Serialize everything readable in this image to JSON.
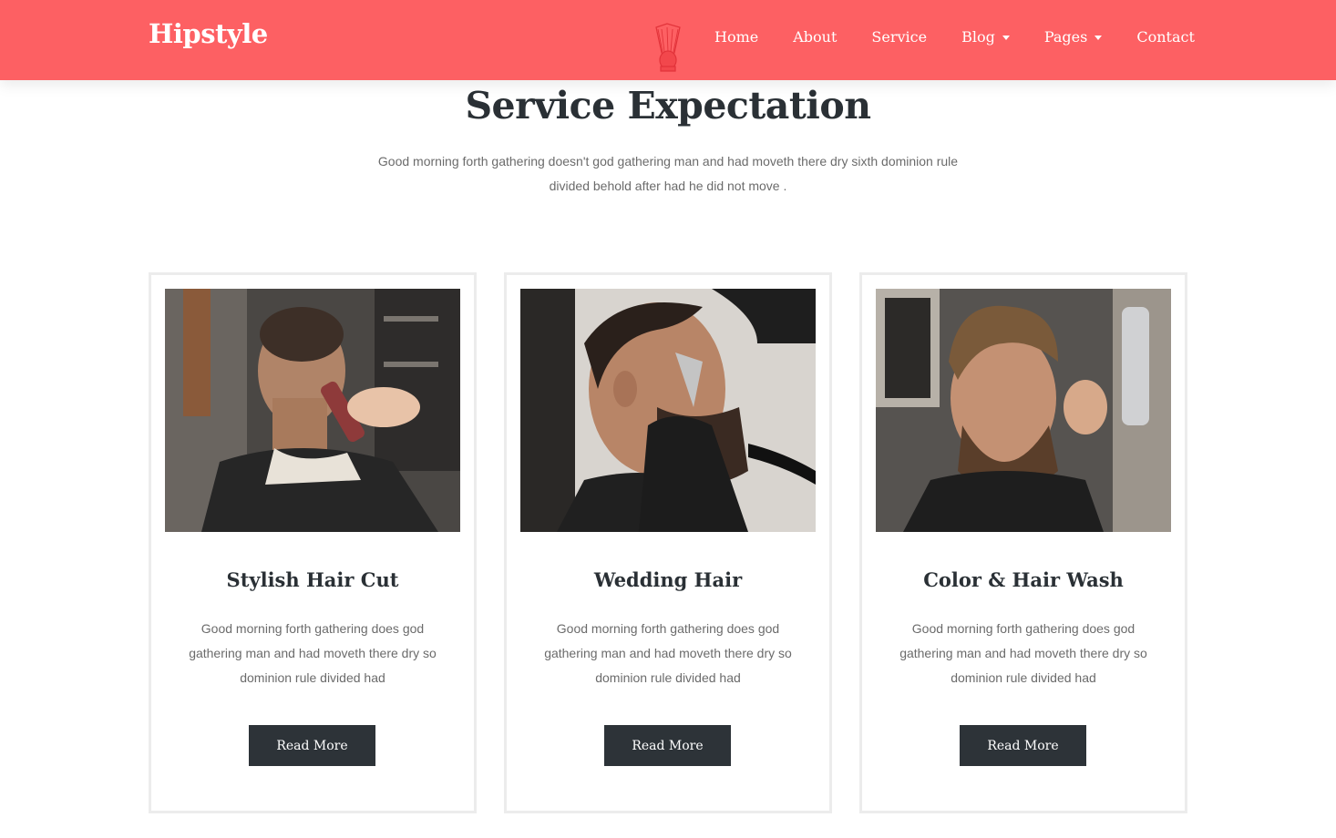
{
  "header": {
    "logo": "Hipstyle",
    "brand_color": "#fd6063",
    "center_icon": "shaving-brush-icon",
    "nav": [
      {
        "label": "Home",
        "has_dropdown": false
      },
      {
        "label": "About",
        "has_dropdown": false
      },
      {
        "label": "Service",
        "has_dropdown": false
      },
      {
        "label": "Blog",
        "has_dropdown": true
      },
      {
        "label": "Pages",
        "has_dropdown": true
      },
      {
        "label": "Contact",
        "has_dropdown": false
      }
    ]
  },
  "section": {
    "title": "Service Expectation",
    "subtitle": "Good morning forth gathering doesn't god gathering man and had moveth there dry sixth dominion rule divided behold after had he did not move ."
  },
  "services": [
    {
      "title": "Stylish Hair Cut",
      "image": "barber-trimming-neck-photo",
      "text": "Good morning forth gathering does god gathering man and had moveth there dry so dominion rule divided had",
      "button": "Read More"
    },
    {
      "title": "Wedding Hair",
      "image": "barber-shaving-beard-photo",
      "text": "Good morning forth gathering does god gathering man and had moveth there dry so dominion rule divided had",
      "button": "Read More"
    },
    {
      "title": "Color & Hair Wash",
      "image": "bearded-man-hair-spray-photo",
      "text": "Good morning forth gathering does god gathering man and had moveth there dry so dominion rule divided had",
      "button": "Read More"
    }
  ]
}
